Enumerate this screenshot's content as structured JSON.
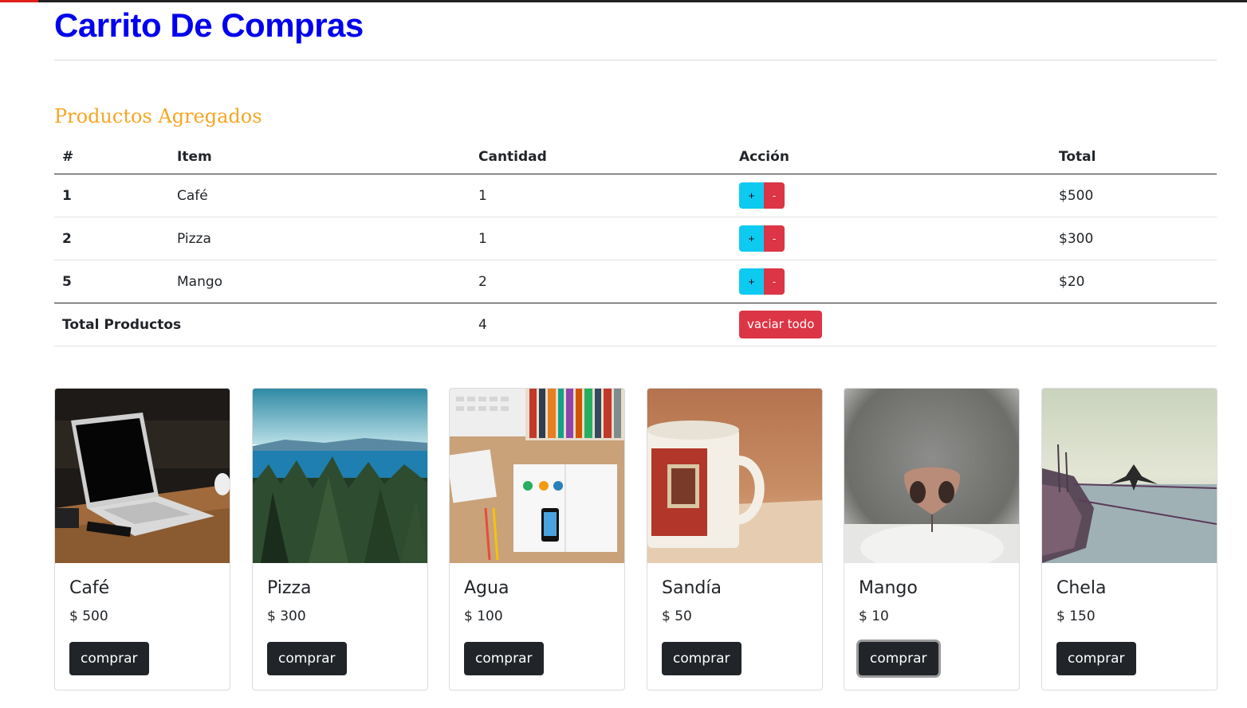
{
  "header": {
    "title": "Carrito De Compras"
  },
  "cart": {
    "heading": "Productos Agregados",
    "columns": [
      "#",
      "Item",
      "Cantidad",
      "Acción",
      "Total"
    ],
    "rows": [
      {
        "id": "1",
        "item": "Café",
        "qty": "1",
        "total": "$500"
      },
      {
        "id": "2",
        "item": "Pizza",
        "qty": "1",
        "total": "$300"
      },
      {
        "id": "5",
        "item": "Mango",
        "qty": "2",
        "total": "$20"
      }
    ],
    "plus_label": "+",
    "minus_label": "-",
    "footer": {
      "label": "Total Productos",
      "qty": "4",
      "empty_label": "vaciar todo"
    }
  },
  "products": [
    {
      "name": "Café",
      "price": "$ 500",
      "button": "comprar",
      "image": "laptop-on-wooden-desk-photo"
    },
    {
      "name": "Pizza",
      "price": "$ 300",
      "button": "comprar",
      "image": "forest-and-lake-landscape-photo"
    },
    {
      "name": "Agua",
      "price": "$ 100",
      "button": "comprar",
      "image": "desk-with-books-and-phone-photo"
    },
    {
      "name": "Sandía",
      "price": "$ 50",
      "button": "comprar",
      "image": "coffee-mug-photo"
    },
    {
      "name": "Mango",
      "price": "$ 10",
      "button": "comprar",
      "image": "cat-nose-closeup-photo"
    },
    {
      "name": "Chela",
      "price": "$ 150",
      "button": "comprar",
      "image": "bird-on-boat-rope-photo"
    }
  ],
  "colors": {
    "title": "#0000ee",
    "subtitle": "#f5a623",
    "info": "#0dcaf0",
    "danger": "#dc3545",
    "dark": "#212529"
  }
}
